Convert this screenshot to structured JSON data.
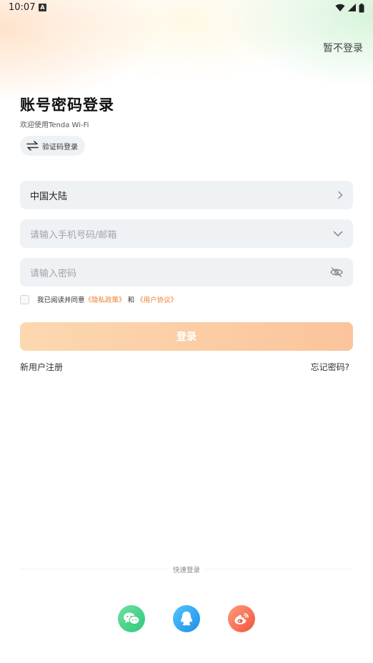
{
  "status_bar": {
    "time": "10:07",
    "notification_badge": "A"
  },
  "header": {
    "skip_label": "暂不登录"
  },
  "login": {
    "title": "账号密码登录",
    "subtitle": "欢迎使用Tenda Wi-Fi",
    "switch_mode_label": "验证码登录"
  },
  "form": {
    "region_value": "中国大陆",
    "phone_placeholder": "请输入手机号码/邮箱",
    "password_placeholder": "请输入密码"
  },
  "agreement": {
    "prefix": "我已阅读并同意",
    "privacy_link": "《隐私政策》",
    "and": "和",
    "terms_link": "《用户协议》"
  },
  "actions": {
    "login_label": "登录",
    "register_label": "新用户注册",
    "forgot_label": "忘记密码?"
  },
  "quick_login": {
    "label": "快速登录"
  },
  "colors": {
    "accent": "#f07a2b",
    "login_button": "#fbc49c",
    "field_bg": "#eff2f5",
    "wechat": "#2fc97a",
    "qq": "#1b8fe8",
    "weibo": "#f0563c"
  },
  "icons": [
    "swap-icon",
    "chevron-right-icon",
    "chevron-down-icon",
    "eye-off-icon",
    "wechat-icon",
    "qq-icon",
    "weibo-icon",
    "wifi-icon",
    "signal-icon",
    "battery-icon"
  ]
}
